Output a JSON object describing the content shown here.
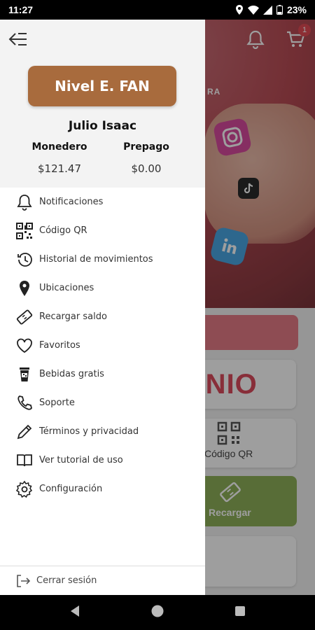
{
  "status": {
    "time": "11:27",
    "battery": "23%"
  },
  "cart": {
    "badge": "1"
  },
  "hero": {
    "partial_text": "RA"
  },
  "bg_cards": {
    "banner_partial": "ENIO",
    "qr_label": "Código QR",
    "recharge_label": "Recargar"
  },
  "drawer": {
    "level": "Nivel E. FAN",
    "user_name": "Julio Isaac",
    "wallet": {
      "monedero_label": "Monedero",
      "monedero_value": "$121.47",
      "prepago_label": "Prepago",
      "prepago_value": "$0.00"
    },
    "menu": [
      {
        "label": "Notificaciones",
        "icon": "bell-icon"
      },
      {
        "label": "Código QR",
        "icon": "qr-icon"
      },
      {
        "label": "Historial de movimientos",
        "icon": "history-icon"
      },
      {
        "label": "Ubicaciones",
        "icon": "location-pin-icon"
      },
      {
        "label": "Recargar saldo",
        "icon": "ticket-icon"
      },
      {
        "label": "Favoritos",
        "icon": "heart-icon"
      },
      {
        "label": "Bebidas gratis",
        "icon": "cup-icon"
      },
      {
        "label": "Soporte",
        "icon": "phone-icon"
      },
      {
        "label": "Términos y privacidad",
        "icon": "pencil-icon"
      },
      {
        "label": "Ver tutorial de uso",
        "icon": "book-icon"
      },
      {
        "label": "Configuración",
        "icon": "gear-icon"
      }
    ],
    "logout": "Cerrar sesión"
  },
  "colors": {
    "level_bg": "#a86b3d",
    "accent_red": "#dc4b5c",
    "recharge_green": "#8fb05a"
  }
}
